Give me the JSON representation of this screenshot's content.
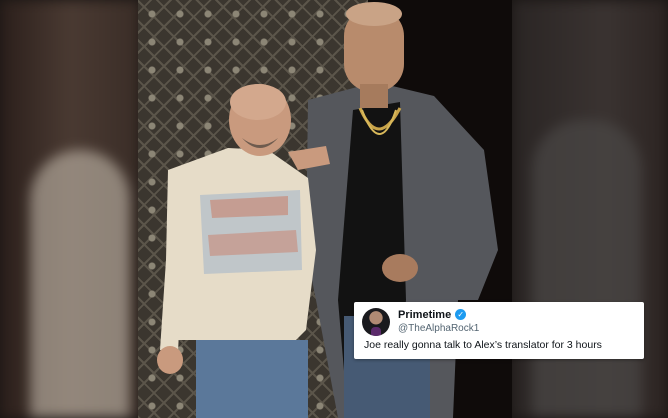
{
  "tweet": {
    "display_name": "Primetime",
    "handle": "@TheAlphaRock1",
    "text": "Joe really gonna talk to Alex’s translator for 3 hours",
    "verified_icon": "verified-badge-icon",
    "accent": "#1d9bf0"
  }
}
